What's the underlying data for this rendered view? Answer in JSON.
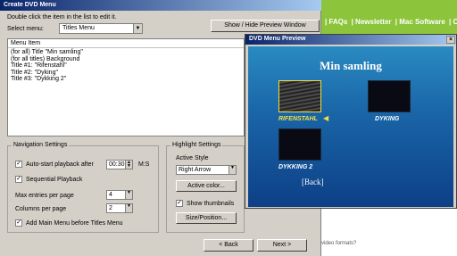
{
  "site": {
    "nav": [
      "| FAQs",
      "| Newsletter",
      "| Mac Software",
      "| C"
    ],
    "footer_text": "video formats?"
  },
  "dialog": {
    "title": "Create DVD Menu",
    "hint": "Double click the item in the list to edit it.",
    "preview_toggle_label": "Show / Hide Preview Window",
    "select_menu_label": "Select menu:",
    "select_menu_value": "Titles Menu",
    "list": {
      "header": "Menu Item",
      "items": [
        "(for all) Title \"Min samling\"",
        "(for all titles) Background",
        "Title #1: \"Rifenstahl\"",
        "Title #2: \"Dyking\"",
        "Title #3: \"Dykking 2\""
      ]
    },
    "navigation": {
      "title": "Navigation Settings",
      "autostart_label": "Auto-start playback after",
      "autostart_checked": true,
      "autostart_time": "00:30",
      "autostart_unit": "M:S",
      "sequential_label": "Sequential Playback",
      "sequential_checked": true,
      "max_entries_label": "Max entries per page",
      "max_entries_value": "4",
      "columns_label": "Columns per page",
      "columns_value": "2",
      "add_main_label": "Add Main Menu before Titles Menu",
      "add_main_checked": true
    },
    "highlight": {
      "title": "Highlight Settings",
      "active_style_label": "Active Style",
      "active_style_value": "Right Arrow",
      "active_color_label": "Active color...",
      "show_thumbnails_label": "Show thumbnails",
      "show_thumbnails_checked": true,
      "size_position_label": "Size/Position..."
    },
    "back_label": "< Back",
    "next_label": "Next >"
  },
  "preview": {
    "title": "DVD Menu Preview",
    "close_glyph": "×",
    "heading": "Min samling",
    "items": [
      {
        "label": "RIFENSTAHL",
        "selected": true
      },
      {
        "label": "DYKING",
        "selected": false
      },
      {
        "label": "DYKKING 2",
        "selected": false
      }
    ],
    "selection_arrow": "◀",
    "back_label": "[Back]"
  },
  "colors": {
    "site_green": "#8cc43c",
    "titlebar_start": "#0a246a",
    "titlebar_end": "#a6caf0",
    "highlight_yellow": "#f2e040",
    "preview_blue": "#1a66a8"
  }
}
